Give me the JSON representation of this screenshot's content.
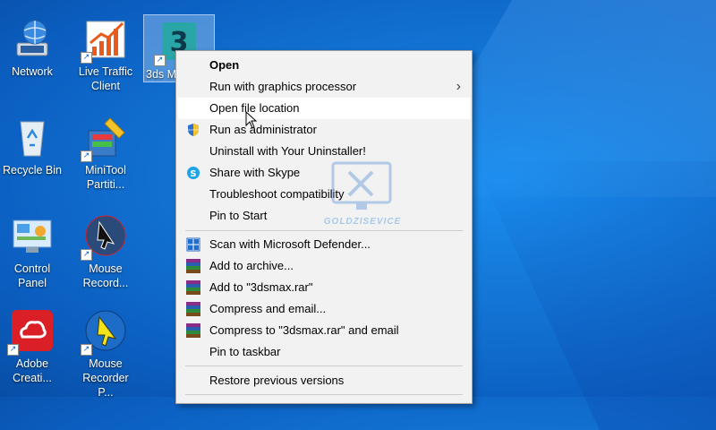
{
  "desktop": {
    "icons": [
      {
        "label": "Network"
      },
      {
        "label": "Live Traffic Client"
      },
      {
        "label": "3ds M"
      },
      {
        "label": "Recycle Bin"
      },
      {
        "label": "MiniTool Partiti..."
      },
      {
        "label": "Control Panel"
      },
      {
        "label": "Mouse Record..."
      },
      {
        "label": "Adobe Creati..."
      },
      {
        "label": "Mouse Recorder P..."
      }
    ]
  },
  "context_menu": {
    "items": [
      {
        "label": "Open"
      },
      {
        "label": "Run with graphics processor"
      },
      {
        "label": "Open file location"
      },
      {
        "label": "Run as administrator"
      },
      {
        "label": "Uninstall with Your Uninstaller!"
      },
      {
        "label": "Share with Skype"
      },
      {
        "label": "Troubleshoot compatibility"
      },
      {
        "label": "Pin to Start"
      },
      {
        "label": "Scan with Microsoft Defender..."
      },
      {
        "label": "Add to archive..."
      },
      {
        "label": "Add to \"3dsmax.rar\""
      },
      {
        "label": "Compress and email..."
      },
      {
        "label": "Compress to \"3dsmax.rar\" and email"
      },
      {
        "label": "Pin to taskbar"
      },
      {
        "label": "Restore previous versions"
      }
    ]
  },
  "watermark": {
    "text": "GOLDZISEVICE"
  },
  "colors": {
    "desktop_blue": "#1478d8",
    "menu_bg": "#f2f2f2",
    "menu_hover": "#ffffff"
  }
}
